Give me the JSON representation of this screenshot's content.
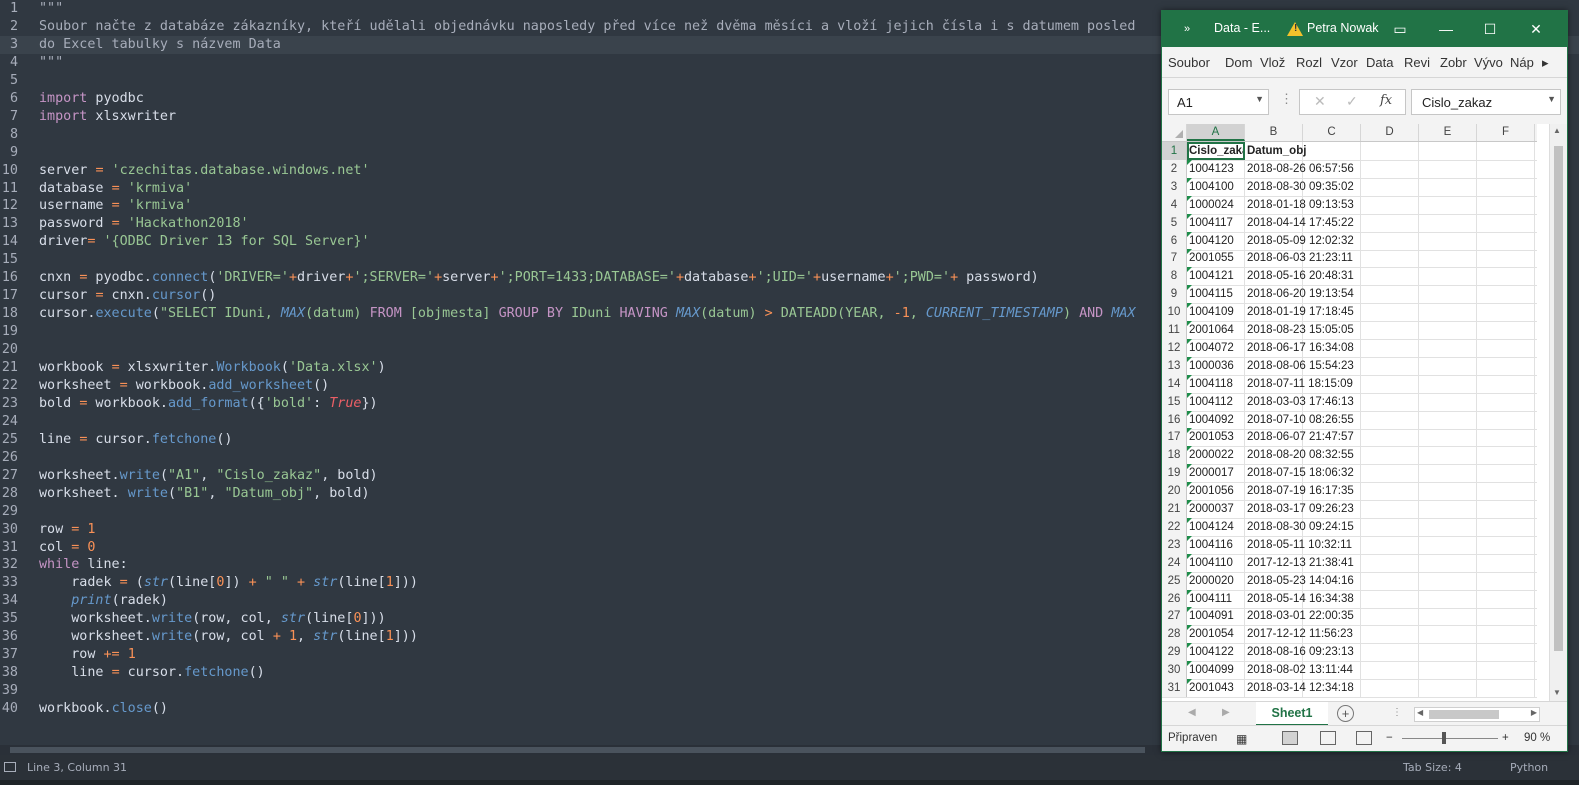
{
  "editor": {
    "lines": [
      {
        "n": "1",
        "html": "<span class=\"cm\">\"\"\"</span>"
      },
      {
        "n": "2",
        "html": "<span class=\"cm\">Soubor načte z databáze zákazníky, kteří udělali objednávku naposledy před více než dvěma měsíci a vloží jejich čísla i s datumem posled</span>"
      },
      {
        "n": "3",
        "html": "<span class=\"cm\">do Excel tabulky s názvem Data</span>",
        "current": true
      },
      {
        "n": "4",
        "html": "<span class=\"cm\">\"\"\"</span>"
      },
      {
        "n": "5",
        "html": ""
      },
      {
        "n": "6",
        "html": "<span class=\"kw\">import</span> pyodbc"
      },
      {
        "n": "7",
        "html": "<span class=\"kw\">import</span> xlsxwriter"
      },
      {
        "n": "8",
        "html": ""
      },
      {
        "n": "9",
        "html": ""
      },
      {
        "n": "10",
        "html": "server <span class=\"op\">=</span> <span class=\"st\">'czechitas.database.windows.net'</span>"
      },
      {
        "n": "11",
        "html": "database <span class=\"op\">=</span> <span class=\"st\">'krmiva'</span>"
      },
      {
        "n": "12",
        "html": "username <span class=\"op\">=</span> <span class=\"st\">'krmiva'</span>"
      },
      {
        "n": "13",
        "html": "password <span class=\"op\">=</span> <span class=\"st\">'Hackathon2018'</span>"
      },
      {
        "n": "14",
        "html": "driver<span class=\"op\">=</span> <span class=\"st\">'{ODBC Driver 13 for SQL Server}'</span>"
      },
      {
        "n": "15",
        "html": ""
      },
      {
        "n": "16",
        "html": "cnxn <span class=\"op\">=</span> pyodbc.<span class=\"fn\">connect</span>(<span class=\"st\">'DRIVER='</span><span class=\"op\">+</span>driver<span class=\"op\">+</span><span class=\"st\">';SERVER='</span><span class=\"op\">+</span>server<span class=\"op\">+</span><span class=\"st\">';PORT=1433;DATABASE='</span><span class=\"op\">+</span>database<span class=\"op\">+</span><span class=\"st\">';UID='</span><span class=\"op\">+</span>username<span class=\"op\">+</span><span class=\"st\">';PWD='</span><span class=\"op\">+</span> password)"
      },
      {
        "n": "17",
        "html": "cursor <span class=\"op\">=</span> cnxn.<span class=\"fn\">cursor</span>()"
      },
      {
        "n": "18",
        "html": "cursor.<span class=\"fn\">execute</span>(<span class=\"st\">\"SELECT IDuni, </span><span class=\"it\">MAX</span><span class=\"st\">(datum) </span><span class=\"kw\">FROM</span><span class=\"st\"> [objmesta] </span><span class=\"kw\">GROUP BY</span><span class=\"st\"> IDuni </span><span class=\"kw\">HAVING</span><span class=\"st\"> </span><span class=\"it\">MAX</span><span class=\"st\">(datum) </span><span class=\"op\">&gt;</span><span class=\"st\"> DATEADD(YEAR, </span><span class=\"op\">-</span><span class=\"nu\">1</span><span class=\"st\">, </span><span class=\"it\">CURRENT_TIMESTAMP</span><span class=\"st\">) </span><span class=\"kw\">AND</span><span class=\"st\"> </span><span class=\"it\">MAX</span>"
      },
      {
        "n": "19",
        "html": ""
      },
      {
        "n": "20",
        "html": ""
      },
      {
        "n": "21",
        "html": "workbook <span class=\"op\">=</span> xlsxwriter.<span class=\"fn\">Workbook</span>(<span class=\"st\">'Data.xlsx'</span>)"
      },
      {
        "n": "22",
        "html": "worksheet <span class=\"op\">=</span> workbook.<span class=\"fn\">add_worksheet</span>()"
      },
      {
        "n": "23",
        "html": "bold <span class=\"op\">=</span> workbook.<span class=\"fn\">add_format</span>({<span class=\"st\">'bold'</span>: <span class=\"tr\">True</span>})"
      },
      {
        "n": "24",
        "html": ""
      },
      {
        "n": "25",
        "html": "line <span class=\"op\">=</span> cursor.<span class=\"fn\">fetchone</span>()"
      },
      {
        "n": "26",
        "html": ""
      },
      {
        "n": "27",
        "html": "worksheet.<span class=\"fn\">write</span>(<span class=\"st\">\"A1\"</span>, <span class=\"st\">\"Cislo_zakaz\"</span>, bold)"
      },
      {
        "n": "28",
        "html": "worksheet. <span class=\"fn\">write</span>(<span class=\"st\">\"B1\"</span>, <span class=\"st\">\"Datum_obj\"</span>, bold)"
      },
      {
        "n": "29",
        "html": ""
      },
      {
        "n": "30",
        "html": "row <span class=\"op\">=</span> <span class=\"nu\">1</span>"
      },
      {
        "n": "31",
        "html": "col <span class=\"op\">=</span> <span class=\"nu\">0</span>"
      },
      {
        "n": "32",
        "html": "<span class=\"kw\">while</span> line:"
      },
      {
        "n": "33",
        "html": "    radek <span class=\"op\">=</span> (<span class=\"it\">str</span>(line[<span class=\"nu\">0</span>]) <span class=\"op\">+</span> <span class=\"st\">\" \"</span> <span class=\"op\">+</span> <span class=\"it\">str</span>(line[<span class=\"nu\">1</span>]))"
      },
      {
        "n": "34",
        "html": "    <span class=\"it\">print</span>(radek)"
      },
      {
        "n": "35",
        "html": "    worksheet.<span class=\"fn\">write</span>(row, col, <span class=\"it\">str</span>(line[<span class=\"nu\">0</span>]))"
      },
      {
        "n": "36",
        "html": "    worksheet.<span class=\"fn\">write</span>(row, col <span class=\"op\">+</span> <span class=\"nu\">1</span>, <span class=\"it\">str</span>(line[<span class=\"nu\">1</span>]))"
      },
      {
        "n": "37",
        "html": "    row <span class=\"op\">+=</span> <span class=\"nu\">1</span>"
      },
      {
        "n": "38",
        "html": "    line <span class=\"op\">=</span> cursor.<span class=\"fn\">fetchone</span>()"
      },
      {
        "n": "39",
        "html": ""
      },
      {
        "n": "40",
        "html": "workbook.<span class=\"fn\">close</span>()"
      }
    ]
  },
  "statusbar": {
    "position": "Line 3, Column 31",
    "tab_size": "Tab Size: 4",
    "language": "Python"
  },
  "excel": {
    "quick_access": "»",
    "title": "Data  -  E...",
    "user": "Petra Nowak",
    "ribbon_tabs": [
      "Soubor",
      "Dom",
      "Vlož",
      "Rozl",
      "Vzor",
      "Data",
      "Revi",
      "Zobr",
      "Vývo",
      "Náp"
    ],
    "ribbon_more": "▸",
    "name_box": "A1",
    "formula_value": "Cislo_zakaz",
    "fx": "fx",
    "columns": [
      "A",
      "B",
      "C",
      "D",
      "E",
      "F"
    ],
    "header_row": [
      "Cislo_zakaz",
      "Datum_obj"
    ],
    "rows": [
      [
        "1004123",
        "2018-08-26 06:57:56"
      ],
      [
        "1004100",
        "2018-08-30 09:35:02"
      ],
      [
        "1000024",
        "2018-01-18 09:13:53"
      ],
      [
        "1004117",
        "2018-04-14 17:45:22"
      ],
      [
        "1004120",
        "2018-05-09 12:02:32"
      ],
      [
        "2001055",
        "2018-06-03 21:23:11"
      ],
      [
        "1004121",
        "2018-05-16 20:48:31"
      ],
      [
        "1004115",
        "2018-06-20 19:13:54"
      ],
      [
        "1004109",
        "2018-01-19 17:18:45"
      ],
      [
        "2001064",
        "2018-08-23 15:05:05"
      ],
      [
        "1004072",
        "2018-06-17 16:34:08"
      ],
      [
        "1000036",
        "2018-08-06 15:54:23"
      ],
      [
        "1004118",
        "2018-07-11 18:15:09"
      ],
      [
        "1004112",
        "2018-03-03 17:46:13"
      ],
      [
        "1004092",
        "2018-07-10 08:26:55"
      ],
      [
        "2001053",
        "2018-06-07 21:47:57"
      ],
      [
        "2000022",
        "2018-08-20 08:32:55"
      ],
      [
        "2000017",
        "2018-07-15 18:06:32"
      ],
      [
        "2001056",
        "2018-07-19 16:17:35"
      ],
      [
        "2000037",
        "2018-03-17 09:26:23"
      ],
      [
        "1004124",
        "2018-08-30 09:24:15"
      ],
      [
        "1004116",
        "2018-05-11 10:32:11"
      ],
      [
        "1004110",
        "2017-12-13 21:38:41"
      ],
      [
        "2000020",
        "2018-05-23 14:04:16"
      ],
      [
        "1004111",
        "2018-05-14 16:34:38"
      ],
      [
        "1004091",
        "2018-03-01 22:00:35"
      ],
      [
        "2001054",
        "2017-12-12 11:56:23"
      ],
      [
        "1004122",
        "2018-08-16 09:23:13"
      ],
      [
        "1004099",
        "2018-08-02 13:11:44"
      ],
      [
        "2001043",
        "2018-03-14 12:34:18"
      ]
    ],
    "sheet_tab": "Sheet1",
    "add_sheet": "+",
    "status_ready": "Připraven",
    "zoom": "90 %",
    "zoom_minus": "−",
    "zoom_plus": "+"
  },
  "colors": {
    "editor_bg": "#303841",
    "excel_green": "#217346"
  }
}
